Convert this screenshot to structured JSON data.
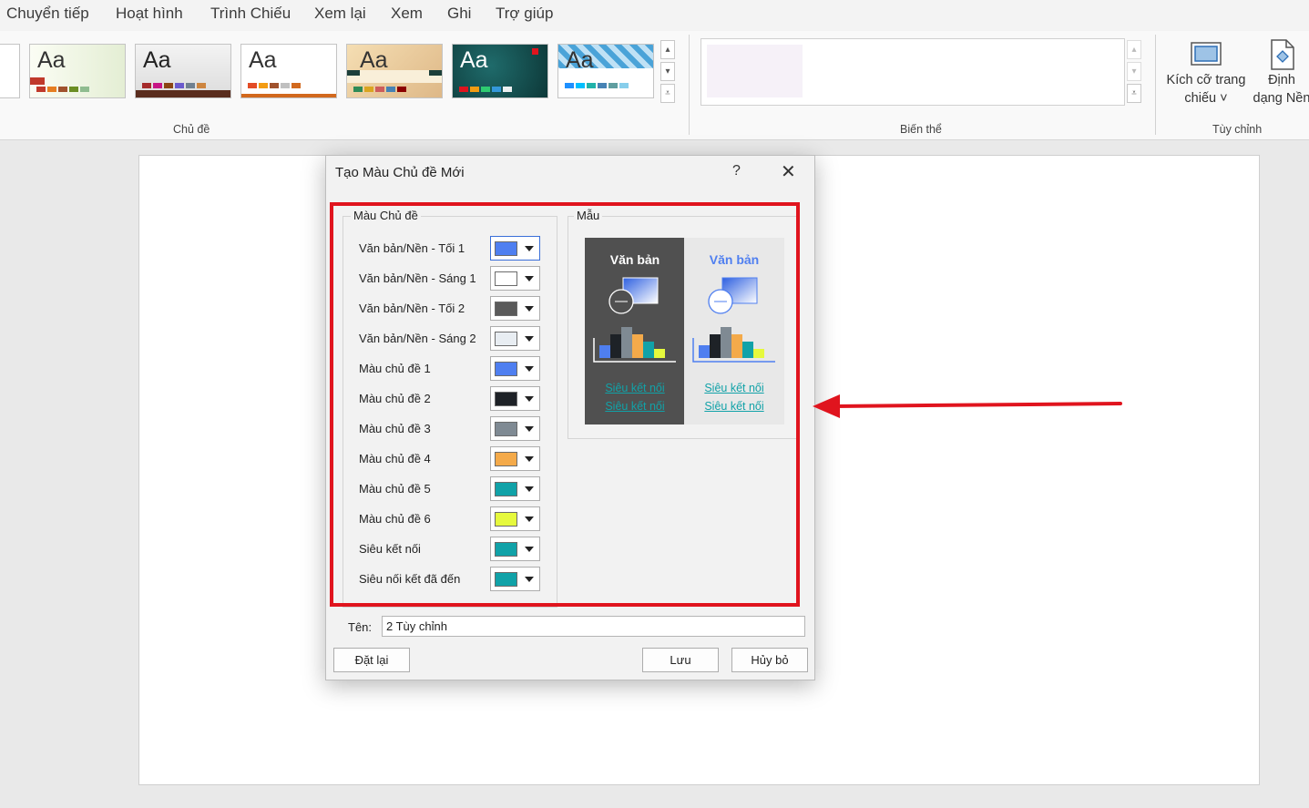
{
  "menu": {
    "tabs": [
      "Chuyển tiếp",
      "Hoạt hình",
      "Trình Chiếu",
      "Xem lại",
      "Xem",
      "Ghi",
      "Trợ giúp"
    ]
  },
  "ribbon": {
    "themes_group": {
      "label": "Chủ đề",
      "thumb_text": "Aa"
    },
    "variants_group": {
      "label": "Biến thể"
    },
    "customize_group": {
      "label": "Tùy chỉnh",
      "slide_size": {
        "line1": "Kích cỡ trang",
        "line2": "chiếu ˅"
      },
      "format_background": {
        "line1": "Định",
        "line2": "dạng Nền"
      }
    }
  },
  "dialog": {
    "title": "Tạo Màu Chủ đề Mới",
    "help": "?",
    "close": "✕",
    "theme_colors": {
      "legend": "Màu Chủ đề",
      "rows": [
        {
          "label": "Văn bản/Nền - Tối 1",
          "color": "#4f7ff0"
        },
        {
          "label": "Văn bản/Nền - Sáng 1",
          "color": "#ffffff"
        },
        {
          "label": "Văn bản/Nền - Tối 2",
          "color": "#5a5a5a"
        },
        {
          "label": "Văn bản/Nền - Sáng 2",
          "color": "#e8edf2"
        },
        {
          "label": "Màu chủ đề 1",
          "color": "#4f7ff0"
        },
        {
          "label": "Màu chủ đề 2",
          "color": "#1e2227"
        },
        {
          "label": "Màu chủ đề 3",
          "color": "#7f8a93"
        },
        {
          "label": "Màu chủ đề 4",
          "color": "#f4aa4a"
        },
        {
          "label": "Màu chủ đề 5",
          "color": "#11a2a8"
        },
        {
          "label": "Màu chủ đề 6",
          "color": "#e6f93d"
        },
        {
          "label": "Siêu kết nối",
          "color": "#11a2a8"
        },
        {
          "label": "Siêu nối kết đã đến",
          "color": "#11a2a8"
        }
      ]
    },
    "sample": {
      "legend": "Mẫu",
      "dark_text": "Văn bản",
      "light_text": "Văn bản",
      "link1": "Siêu kết nối",
      "link2": "Siêu kết nối"
    },
    "name_label": "Tên:",
    "name_value": "2 Tùy chỉnh",
    "reset_button": "Đặt lại",
    "save_button": "Lưu",
    "cancel_button": "Hủy bỏ"
  },
  "colors": {
    "highlight": "#e0141e",
    "accent_blue": "#4f7ff0",
    "link_teal": "#11a2a8"
  }
}
